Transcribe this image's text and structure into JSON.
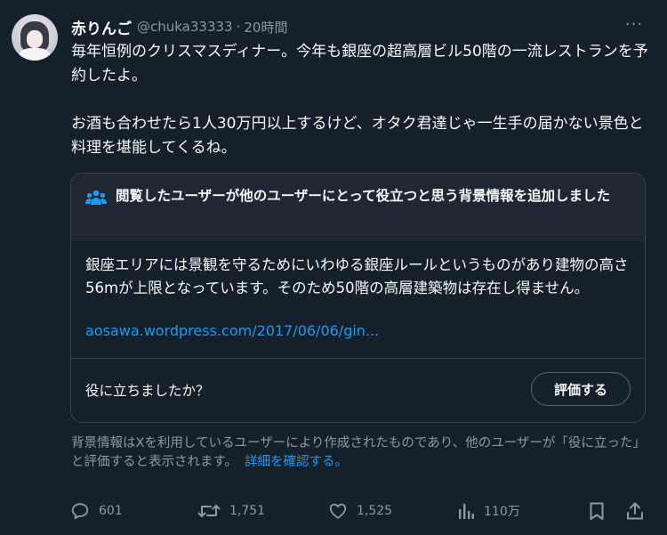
{
  "tweet": {
    "display_name": "赤りんご",
    "handle": "@chuka33333",
    "separator": "·",
    "time": "20時間",
    "more_label": "···",
    "text_lines": [
      "毎年恒例のクリスマスディナー。今年も銀座の超高層ビル50階の一流レストランを予約したよ。",
      "お酒も合わせたら1人30万円以上するけど、オタク君達じゃ一生手の届かない景色と料理を堪能してくるね。"
    ]
  },
  "community_note": {
    "icon": "people-icon",
    "title": "閲覧したユーザーが他のユーザーにとって役立つと思う背景情報を追加しました",
    "body": "銀座エリアには景観を守るためにいわゆる銀座ルールというものがあり建物の高さ56mが上限となっています。そのため50階の高層建築物は存在し得ません。",
    "link": "aosawa.wordpress.com/2017/06/06/gin...",
    "helpful_question": "役に立ちましたか？",
    "rate_button": "評価する"
  },
  "footnote": {
    "text": "背景情報はXを利用しているユーザーにより作成されたものであり、他のユーザーが「役に立った」と評価すると表示されます。",
    "link": "詳細を確認する。"
  },
  "actions": {
    "replies": "601",
    "reposts": "1,751",
    "likes": "1,525",
    "views": "110万",
    "reply_icon": "reply-icon",
    "repost_icon": "repost-icon",
    "like_icon": "heart-icon",
    "views_icon": "views-icon",
    "bookmark_icon": "bookmark-icon",
    "share_icon": "share-icon"
  },
  "colors": {
    "background": "#15202b",
    "text_primary": "#f7f9f9",
    "text_secondary": "#8b98a5",
    "accent": "#1d9bf0",
    "note_header_bg": "#1e2732",
    "border": "#38444d"
  }
}
